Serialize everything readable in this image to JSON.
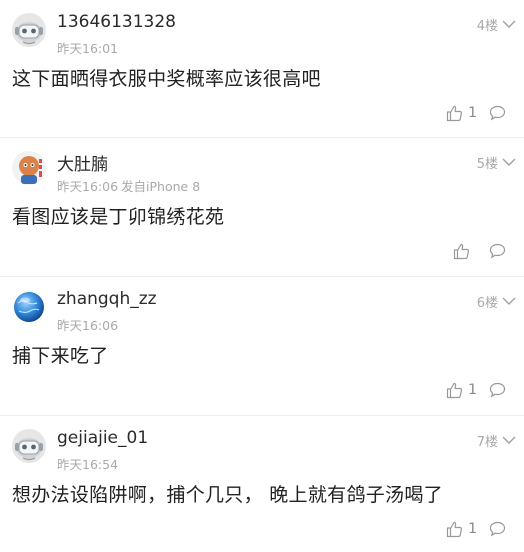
{
  "comments": [
    {
      "username": "13646131328",
      "time": "昨天16:01",
      "device": "",
      "floor": "4楼",
      "text": "这下面晒得衣服中奖概率应该很高吧",
      "likes": "1",
      "avatar": "robot-avatar"
    },
    {
      "username": "大肚腩",
      "time": "昨天16:06",
      "device": "发自iPhone 8",
      "floor": "5楼",
      "text": "看图应该是丁卯锦绣花苑",
      "likes": "",
      "avatar": "cartoon-avatar"
    },
    {
      "username": "zhangqh_zz",
      "time": "昨天16:06",
      "device": "",
      "floor": "6楼",
      "text": "捕下来吃了",
      "likes": "1",
      "avatar": "globe-avatar"
    },
    {
      "username": "gejiajie_01",
      "time": "昨天16:54",
      "device": "",
      "floor": "7楼",
      "text": "想办法设陷阱啊，捕个几只， 晚上就有鸽子汤喝了",
      "likes": "1",
      "avatar": "robot-avatar"
    }
  ],
  "colors": {
    "meta_text": "#a9a9a9",
    "divider": "#ededed",
    "icon": "#999999"
  }
}
